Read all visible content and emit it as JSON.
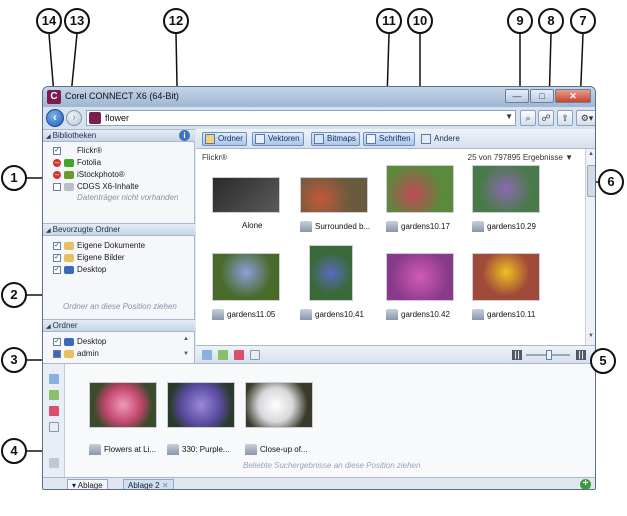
{
  "window": {
    "title": "Corel CONNECT X6 (64-Bit)",
    "address": "flower",
    "buttons": {
      "minimize": "—",
      "maximize": "□",
      "close": "✕"
    }
  },
  "left_panel": {
    "bibliotheken": {
      "header": "Bibliotheken",
      "items": [
        "Flickr®",
        "Fotolia",
        "iStockphoto®",
        "CDGS X6-Inhalte"
      ],
      "note": "Datenträger nicht vorhanden"
    },
    "bevorzugte": {
      "header": "Bevorzugte Ordner",
      "items": [
        "Eigene Dokumente",
        "Eigene Bilder",
        "Desktop"
      ],
      "hint": "Ordner an diese Position ziehen"
    },
    "ordner": {
      "header": "Ordner",
      "items": [
        "Desktop",
        "admin"
      ]
    }
  },
  "filter_tabs": [
    "Ordner",
    "Vektoren",
    "Bitmaps",
    "Schriften",
    "Andere"
  ],
  "content": {
    "source": "Flickr®",
    "results": "25 von 797895 Ergebnisse",
    "thumbnails": [
      {
        "label": "Alone",
        "color": "#3a3a3a"
      },
      {
        "label": "Surrounded b...",
        "color": "#7a6a4e"
      },
      {
        "label": "gardens10.17",
        "color": "#6d8f4a"
      },
      {
        "label": "gardens10.29",
        "color": "#5d7f5a"
      },
      {
        "label": "gardens11.05",
        "color": "#5a7a3e"
      },
      {
        "label": "gardens10.41",
        "color": "#4f6fa8"
      },
      {
        "label": "gardens10.42",
        "color": "#b04a9a"
      },
      {
        "label": "gardens10.11",
        "color": "#c89a2a"
      }
    ]
  },
  "tray": {
    "items": [
      {
        "label": "Flowers at Li...",
        "color": "#c2466e"
      },
      {
        "label": "330: Purple...",
        "color": "#5a4aa0"
      },
      {
        "label": "Close-up of...",
        "color": "#e8e8ea"
      }
    ],
    "hint": "Beliebte Suchergebnisse an diese Position ziehen",
    "tabs": [
      "Ablage",
      "Ablage 2"
    ]
  },
  "callouts": [
    "14",
    "13",
    "12",
    "11",
    "10",
    "9",
    "8",
    "7",
    "1",
    "2",
    "3",
    "4",
    "5",
    "6"
  ]
}
